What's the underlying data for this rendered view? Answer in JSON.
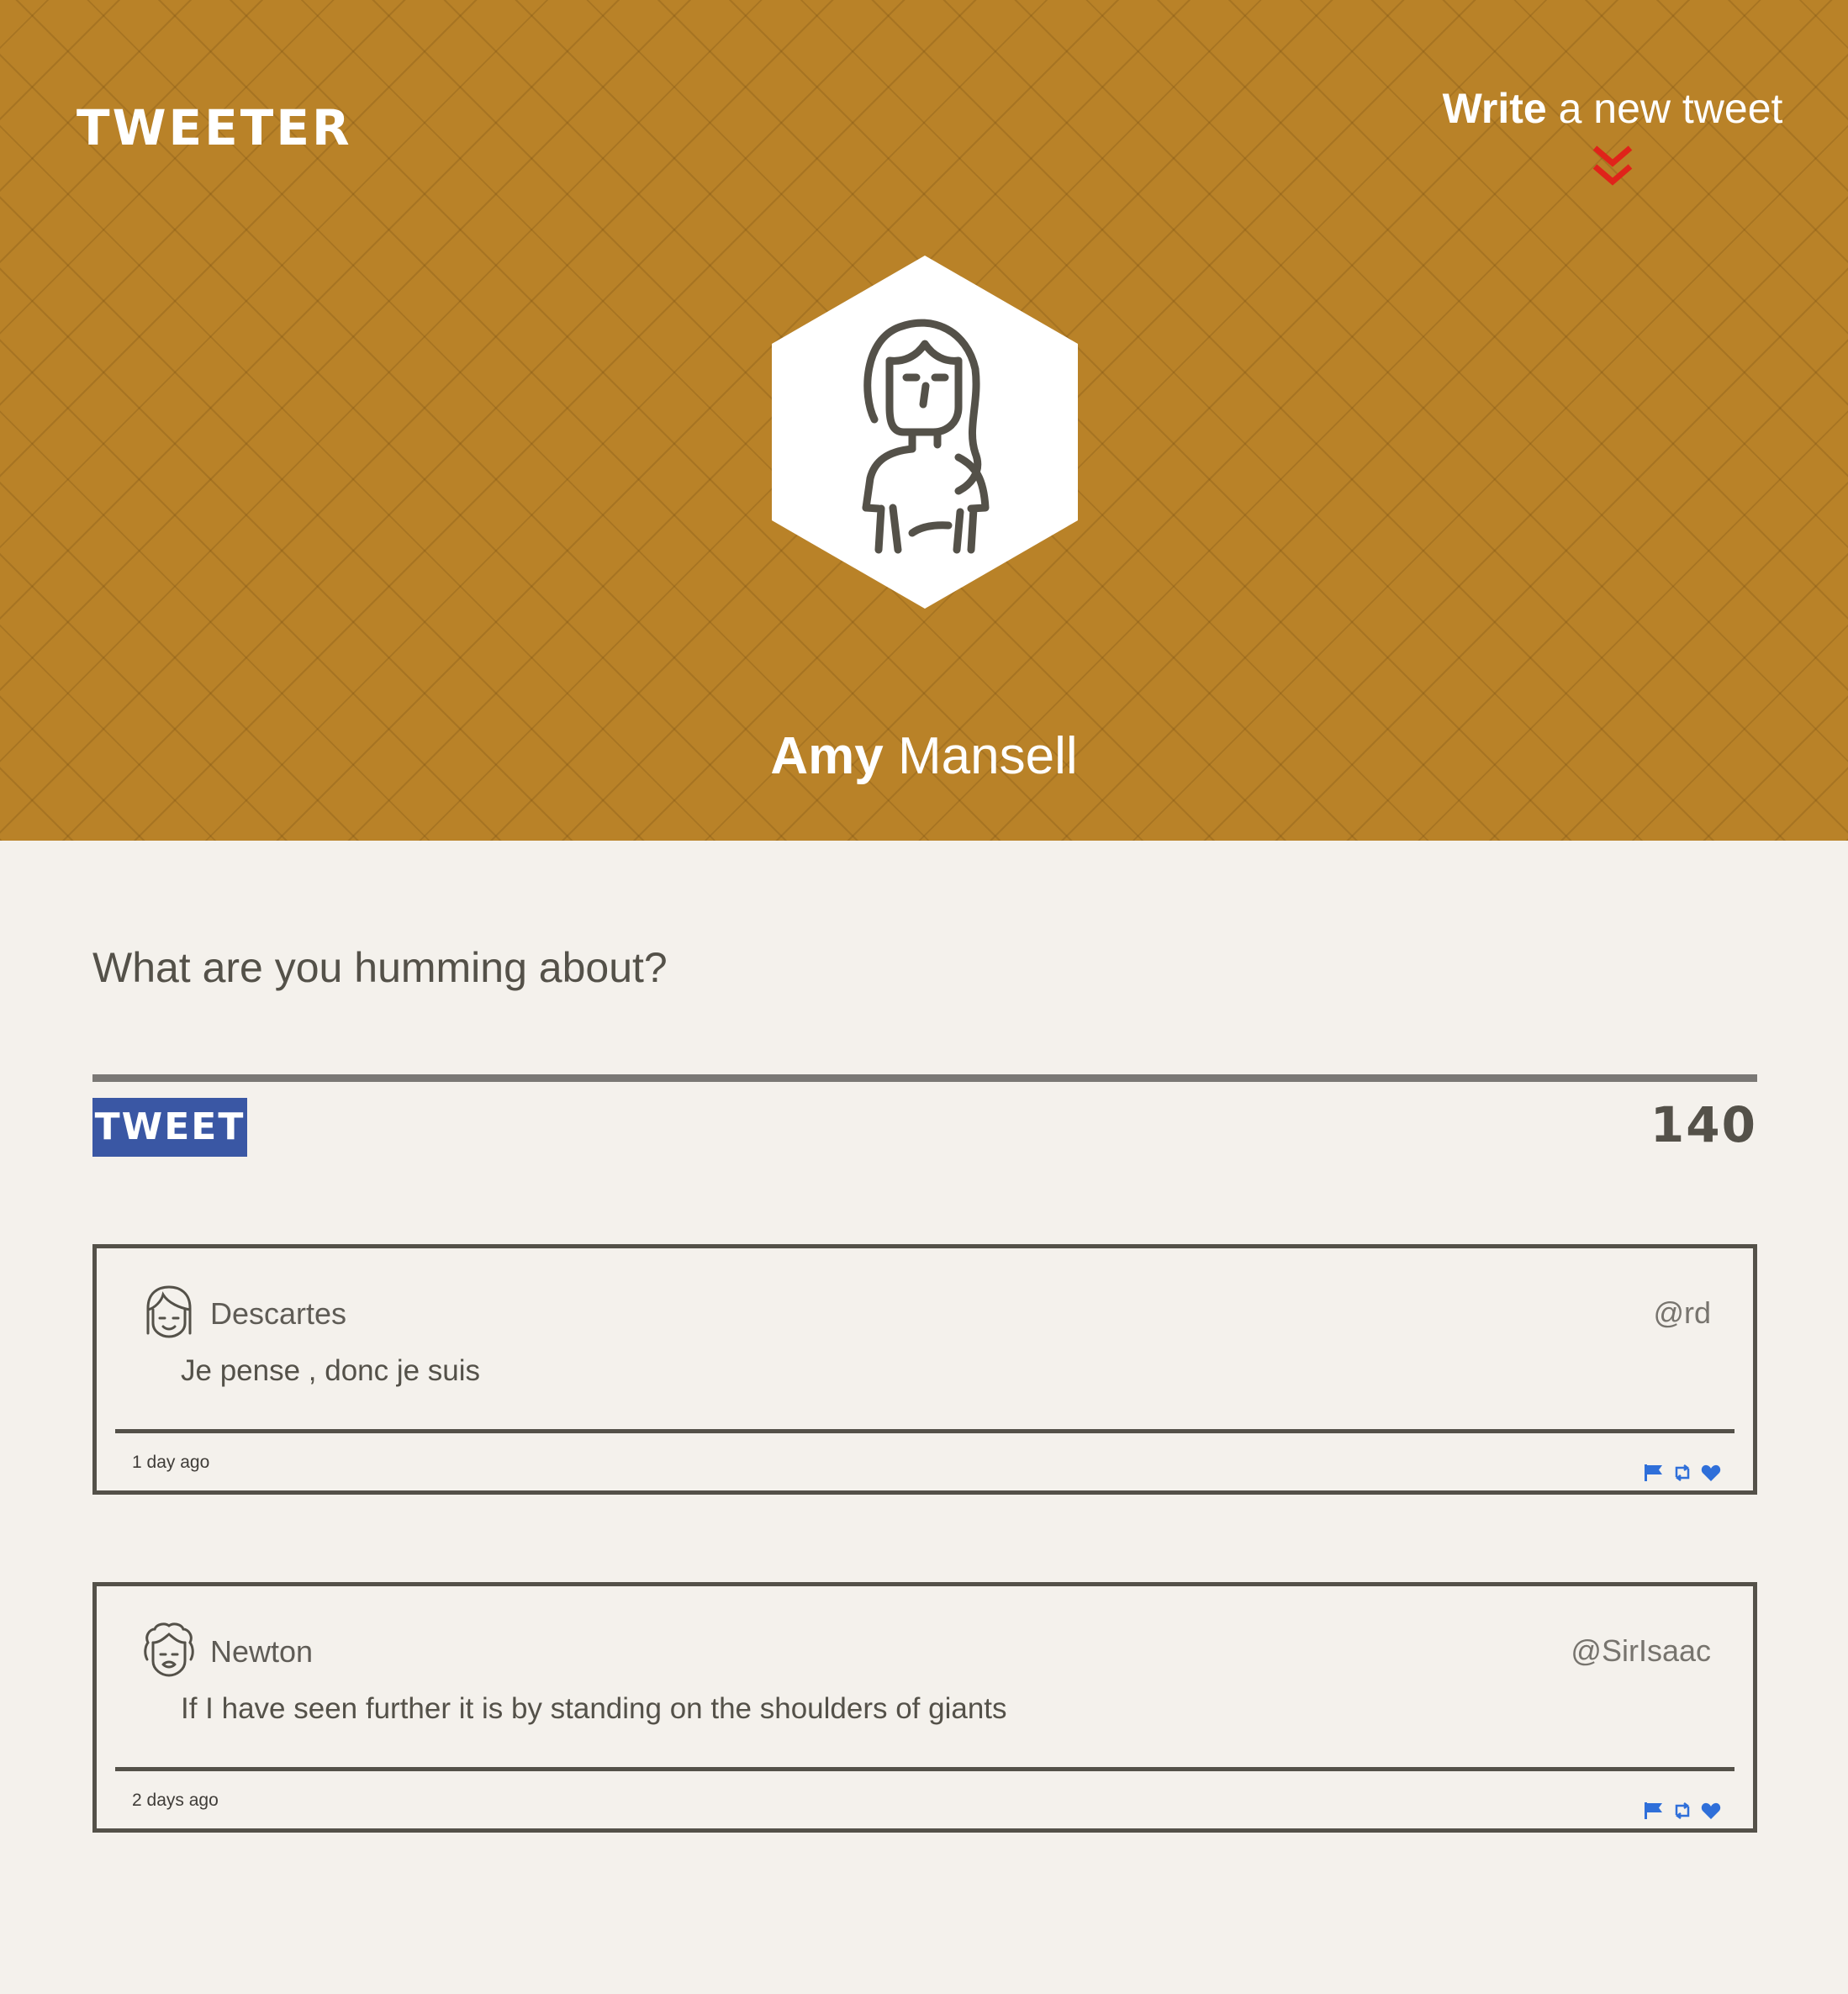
{
  "header": {
    "logo": "Tweeter",
    "compose_bold": "Write",
    "compose_rest": " a new tweet",
    "profile_first": "Amy",
    "profile_last": " Mansell"
  },
  "composer": {
    "prompt": "What are you humming about?",
    "submit_label": "Tweet",
    "counter": "140"
  },
  "tweets": [
    {
      "name": "Descartes",
      "handle": "@rd",
      "body": "Je pense , donc je suis",
      "time": "1 day ago",
      "actions": [
        "flag-icon",
        "retweet-icon",
        "heart-icon"
      ]
    },
    {
      "name": "Newton",
      "handle": "@SirIsaac",
      "body": "If I have seen further it is by standing on the shoulders of giants",
      "time": "2 days ago",
      "actions": [
        "flag-icon",
        "retweet-icon",
        "heart-icon"
      ]
    }
  ],
  "colors": {
    "header_bg": "#b98228",
    "page_bg": "#f4f1ec",
    "button_bg": "#3a57a4",
    "chevron": "#e0231a",
    "action_icons": "#2f6fd9",
    "text": "#545149"
  }
}
